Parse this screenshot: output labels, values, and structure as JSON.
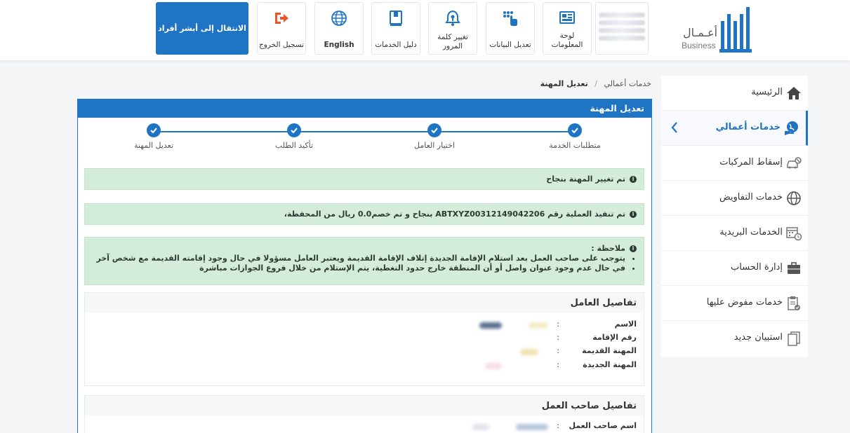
{
  "header": {
    "logo": {
      "arabic": "أعـمـال",
      "english": "Business"
    },
    "buttons": [
      {
        "label": "لوحة المعلومات"
      },
      {
        "label": "تعديل البيانات"
      },
      {
        "label": "تغيير كلمة المرور"
      },
      {
        "label": "دليل الخدمات"
      },
      {
        "label": "English"
      },
      {
        "label": "تسجيل الخروج"
      }
    ],
    "absher_button": "الانتقال إلى أبشر أفراد"
  },
  "sidebar": {
    "items": [
      {
        "label": "الرئيسية",
        "icon": "home-icon"
      },
      {
        "label": "خدمات أعمالي",
        "icon": "globe-hand-icon",
        "active": true
      },
      {
        "label": "إسقاط المركبات",
        "icon": "car-cancel-icon"
      },
      {
        "label": "خدمات التفاويض",
        "icon": "globe-icon"
      },
      {
        "label": "الخدمات البريدية",
        "icon": "calendar-clock-icon"
      },
      {
        "label": "إدارة الحساب",
        "icon": "briefcase-icon"
      },
      {
        "label": "خدمات مفوض عليها",
        "icon": "clipboard-check-icon"
      },
      {
        "label": "استبيان جديد",
        "icon": "copy-icon"
      }
    ]
  },
  "breadcrumb": {
    "root": "خدمات أعمالي",
    "separator": "/",
    "current": "تعديل المهنة"
  },
  "panel": {
    "title": "تعديل المهنة",
    "steps": [
      "متطلبات الخدمة",
      "اختيار العامل",
      "تأكيد الطلب",
      "تعديل المهنة"
    ],
    "alerts": {
      "success": "تم تغيير المهنة بنجاح",
      "transaction": "تم تنفيذ العملية رقم ABTXYZ00312149042206 بنجاح و تم خصم0.0 ريال من المحفظة،",
      "note_title": "ملاحظة :",
      "notes": [
        "يتوجب على صاحب العمل بعد استلام الإقامة الجديدة إتلاف الإقامة القديمة ويعتبر العامل مسؤولا في حال وجود إقامته القديمة مع شخص آخر",
        "في حال عدم وجود عنوان واصل أو أن المنطقة خارج حدود التغطية، يتم الإستلام من خلال فروع الجوازات مباشرة"
      ]
    },
    "worker_section": {
      "title": "تفاصيل العامل",
      "fields": [
        {
          "label": "الاسم",
          "colon": ":"
        },
        {
          "label": "رقم الإقامة",
          "colon": ":"
        },
        {
          "label": "المهنة القديمة",
          "colon": ":"
        },
        {
          "label": "المهنة الجديدة",
          "colon": ":"
        }
      ]
    },
    "employer_section": {
      "title": "تفاصيل صاحب العمل",
      "fields": [
        {
          "label": "اسم صاحب العمل",
          "colon": ":"
        }
      ]
    }
  },
  "colors": {
    "primary": "#1f74c4",
    "success_bg": "#d4edda"
  }
}
